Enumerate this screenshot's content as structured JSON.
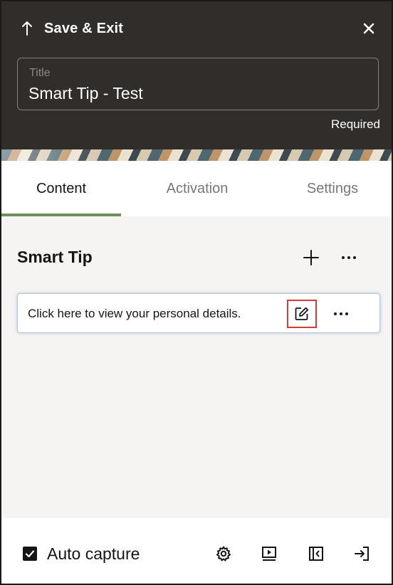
{
  "header": {
    "save_exit_label": "Save & Exit",
    "title_field_label": "Title",
    "title_value": "Smart Tip - Test",
    "required_label": "Required"
  },
  "tabs": [
    {
      "label": "Content",
      "active": true
    },
    {
      "label": "Activation",
      "active": false
    },
    {
      "label": "Settings",
      "active": false
    }
  ],
  "content": {
    "section_title": "Smart Tip",
    "tips": [
      {
        "text": "Click here to view your personal details."
      }
    ]
  },
  "footer": {
    "auto_capture_label": "Auto capture",
    "auto_capture_checked": true
  },
  "colors": {
    "header_bg": "#312d2a",
    "active_tab_accent": "#6f8f5a",
    "highlight_border": "#d63a3a"
  },
  "icons": [
    "arrow-up-icon",
    "close-icon",
    "plus-icon",
    "more-icon",
    "edit-icon",
    "checkbox-icon",
    "gear-icon",
    "play-icon",
    "sidebar-collapse-icon",
    "exit-icon"
  ]
}
